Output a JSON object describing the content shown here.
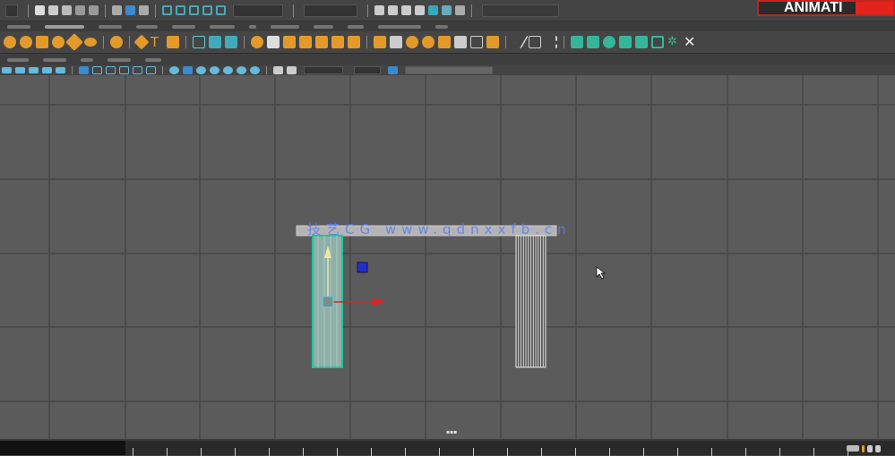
{
  "badge": {
    "text": "ANIMATI",
    "accent": "#e4231a"
  },
  "watermark": "技艺CG www.qdnxxfb.cn",
  "colors": {
    "viewport": "#5b5b5b",
    "grid": "#4a4a4a",
    "selection": "#1fc59a",
    "shelf_icon_orange": "#e39a2b",
    "shelf_icon_teal": "#35b59a"
  },
  "viewport": {
    "objects": [
      "selected-pillar",
      "pillar",
      "beam"
    ],
    "gizmo": "move-tool"
  },
  "timeline": {
    "tick_count": 22
  }
}
